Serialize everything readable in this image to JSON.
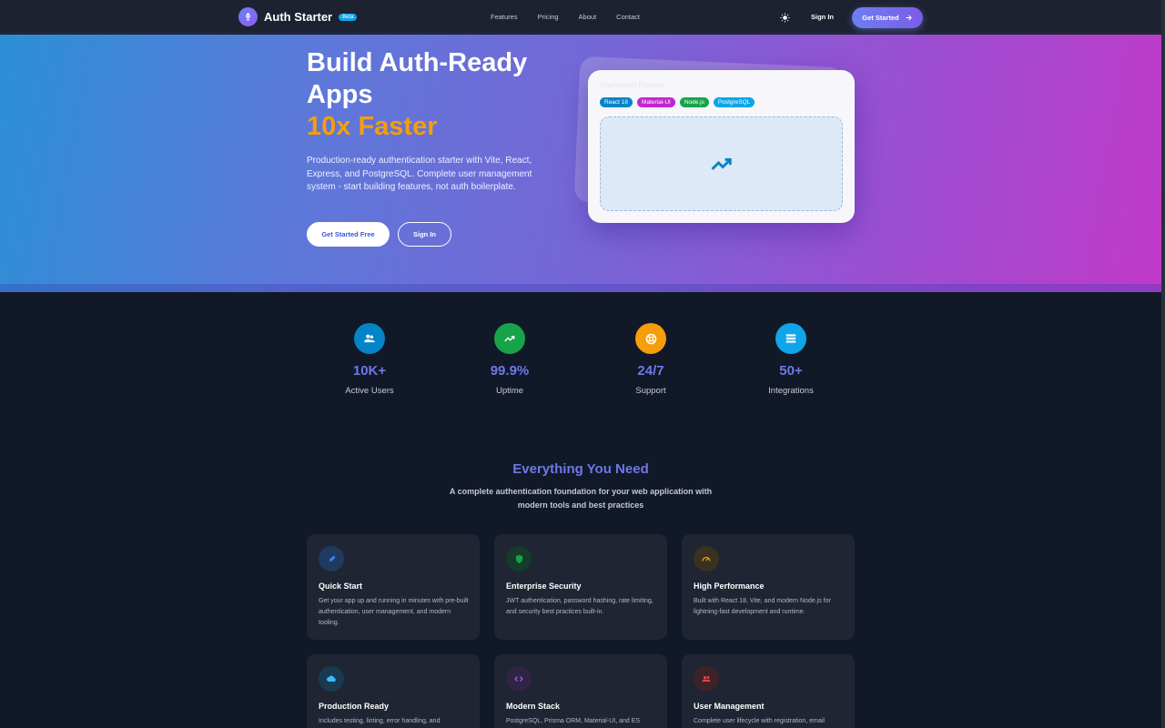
{
  "nav": {
    "brand": "Auth Starter",
    "badge": "Beta",
    "links": [
      "Features",
      "Pricing",
      "About",
      "Contact"
    ],
    "sign_in": "Sign In",
    "cta": "Get Started"
  },
  "hero": {
    "title_line1": "Build Auth-Ready",
    "title_line2": "Apps",
    "title_accent": "10x Faster",
    "subtitle": "Production-ready authentication starter with Vite, React, Express, and PostgreSQL. Complete user management system - start building features, not auth boilerplate.",
    "primary_button": "Get Started Free",
    "secondary_button": "Sign In",
    "preview": {
      "label": "Dashboard Preview",
      "chips": [
        {
          "label": "React 18",
          "color": "#0284c7"
        },
        {
          "label": "Material-UI",
          "color": "#c026d3"
        },
        {
          "label": "Node.js",
          "color": "#16a34a"
        },
        {
          "label": "PostgreSQL",
          "color": "#0ea5e9"
        }
      ]
    }
  },
  "stats": [
    {
      "value": "10K+",
      "label": "Active Users",
      "color": "#0284c7",
      "icon": "users-icon"
    },
    {
      "value": "99.9%",
      "label": "Uptime",
      "color": "#16a34a",
      "icon": "trending-up-icon"
    },
    {
      "value": "24/7",
      "label": "Support",
      "color": "#f59e0b",
      "icon": "support-icon"
    },
    {
      "value": "50+",
      "label": "Integrations",
      "color": "#0ea5e9",
      "icon": "storage-icon"
    }
  ],
  "features": {
    "title": "Everything You Need",
    "subtitle": "A complete authentication foundation for your web application with modern tools and best practices",
    "cards": [
      {
        "title": "Quick Start",
        "desc": "Get your app up and running in minutes with pre-built authentication, user management, and modern tooling.",
        "icon": "rocket-icon",
        "color": "#1d4ed8"
      },
      {
        "title": "Enterprise Security",
        "desc": "JWT authentication, password hashing, rate limiting, and security best practices built-in.",
        "icon": "shield-icon",
        "color": "#16a34a"
      },
      {
        "title": "High Performance",
        "desc": "Built with React 18, Vite, and modern Node.js for lightning-fast development and runtime.",
        "icon": "speed-icon",
        "color": "#f59e0b"
      },
      {
        "title": "Production Ready",
        "desc": "Includes testing, linting, error handling, and",
        "icon": "cloud-icon",
        "color": "#0ea5e9"
      },
      {
        "title": "Modern Stack",
        "desc": "PostgreSQL, Prisma ORM, Material-UI, and ES",
        "icon": "code-icon",
        "color": "#a855f7"
      },
      {
        "title": "User Management",
        "desc": "Complete user lifecycle with registration, email",
        "icon": "group-icon",
        "color": "#ef4444"
      }
    ]
  }
}
